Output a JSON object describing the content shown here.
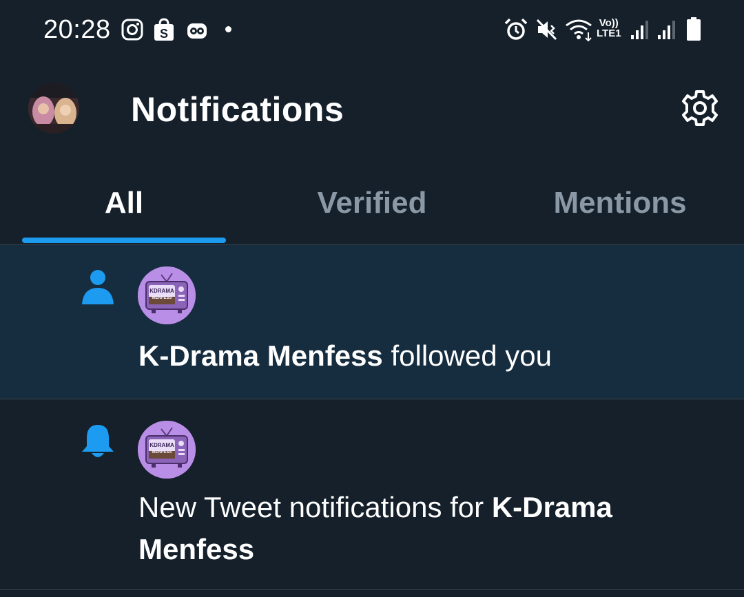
{
  "status_bar": {
    "time": "20:28",
    "network_label_top": "Vo))",
    "network_label_bottom": "LTE1",
    "icons": [
      "instagram-icon",
      "shopee-icon",
      "app-icon",
      "alarm-icon",
      "mute-icon",
      "wifi-icon",
      "signal-icon",
      "signal-icon",
      "battery-icon"
    ]
  },
  "header": {
    "title": "Notifications"
  },
  "tabs": [
    {
      "label": "All",
      "selected": true
    },
    {
      "label": "Verified",
      "selected": false
    },
    {
      "label": "Mentions",
      "selected": false
    }
  ],
  "accent_color": "#1d9bf0",
  "notifications": [
    {
      "type": "follow",
      "icon": "person-icon",
      "account": "K-Drama Menfess",
      "action": " followed you",
      "unread": true
    },
    {
      "type": "tweet-notifications",
      "icon": "bell-icon",
      "prefix": "New Tweet notifications for ",
      "account": "K-Drama Menfess",
      "unread": false
    }
  ]
}
